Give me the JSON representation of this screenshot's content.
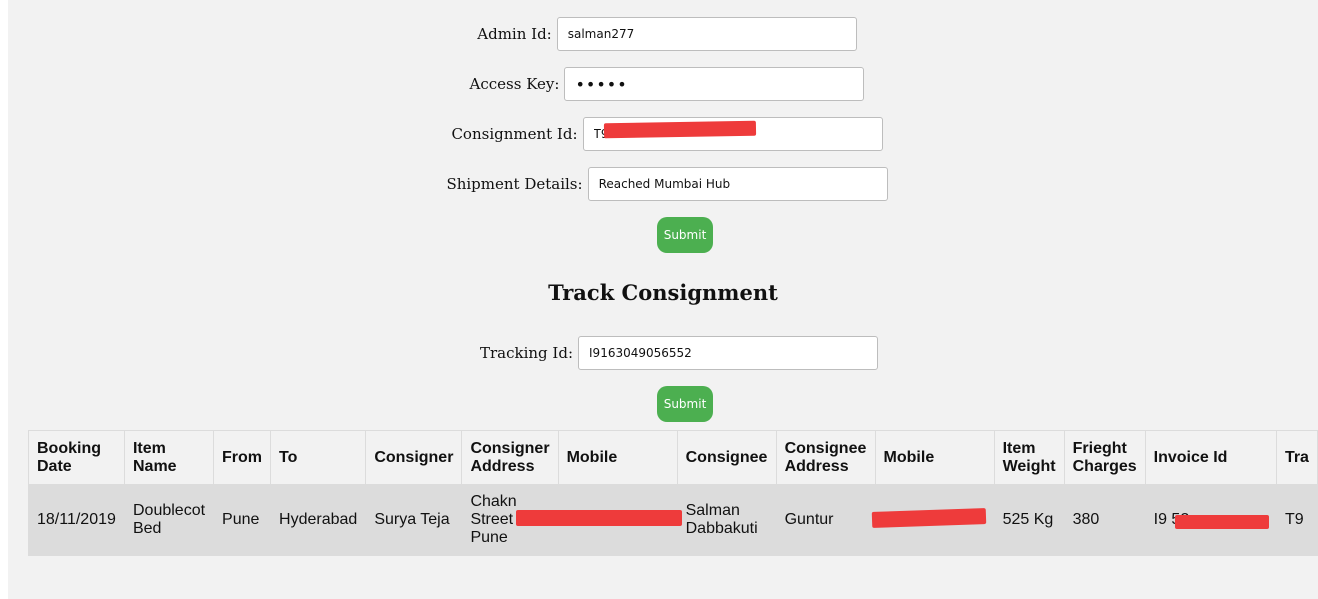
{
  "admin_form": {
    "admin_id_label": "Admin Id:",
    "admin_id_value": "salman277",
    "access_key_label": "Access Key:",
    "access_key_value": "•••••",
    "consignment_id_label": "Consignment Id:",
    "consignment_id_value": "T9",
    "shipment_details_label": "Shipment Details:",
    "shipment_details_value": "Reached Mumbai Hub",
    "submit_label": "Submit"
  },
  "track": {
    "heading": "Track Consignment",
    "tracking_id_label": "Tracking Id:",
    "tracking_id_value": "I9163049056552",
    "submit_label": "Submit"
  },
  "table": {
    "headers": [
      "Booking Date",
      "Item Name",
      "From",
      "To",
      "Consigner",
      "Consigner Address",
      "Mobile",
      "Consignee",
      "Consignee Address",
      "Mobile",
      "Item Weight",
      "Frieght Charges",
      "Invoice Id",
      "Tra"
    ],
    "rows": [
      [
        "18/11/2019",
        "Doublecot Bed",
        "Pune",
        "Hyderabad",
        "Surya Teja",
        "Chakn Street Pune",
        "",
        "Salman Dabbakuti",
        "Guntur",
        "5",
        "525 Kg",
        "380",
        "I9 52",
        "T9"
      ]
    ]
  },
  "colors": {
    "page_background": "#f2f2f2",
    "button": "#4caf50",
    "redaction": "#ee3b3b",
    "row_background": "#dcdcdc"
  }
}
